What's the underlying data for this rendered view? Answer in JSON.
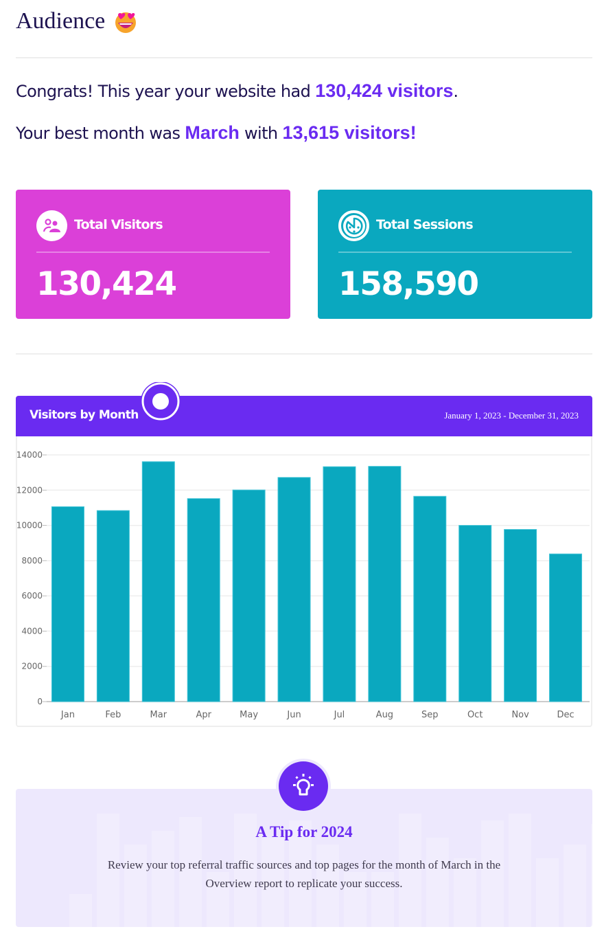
{
  "header": {
    "title": "Audience",
    "emoji_icon": "heart-eyes-emoji"
  },
  "summary": {
    "line1_prefix": "Congrats! This year your website had ",
    "line1_highlight": "130,424 visitors",
    "line1_suffix": ".",
    "line2_prefix": "Your best month was ",
    "line2_month": "March",
    "line2_middle": " with ",
    "line2_highlight": "13,615 visitors!"
  },
  "stats": [
    {
      "label": "Total Visitors",
      "value": "130,424",
      "icon": "users-icon",
      "color": "#db40d8"
    },
    {
      "label": "Total Sessions",
      "value": "158,590",
      "icon": "sessions-clock-icon",
      "color": "#0aa8bf"
    }
  ],
  "chart_section": {
    "title": "Visitors by Month",
    "date_range": "January 1, 2023 - December 31, 2023",
    "header_color": "#6a2bf1",
    "bar_color": "#0aa8bf"
  },
  "chart_data": {
    "type": "bar",
    "title": "Visitors by Month",
    "xlabel": "",
    "ylabel": "",
    "categories": [
      "Jan",
      "Feb",
      "Mar",
      "Apr",
      "May",
      "Jun",
      "Jul",
      "Aug",
      "Sep",
      "Oct",
      "Nov",
      "Dec"
    ],
    "values": [
      11060,
      10840,
      13615,
      11520,
      12010,
      12720,
      13330,
      13350,
      11650,
      10000,
      9770,
      8380
    ],
    "ylim": [
      0,
      14000
    ],
    "yticks": [
      0,
      2000,
      4000,
      6000,
      8000,
      10000,
      12000,
      14000
    ],
    "grid": true,
    "legend": "none"
  },
  "tip": {
    "title": "A Tip for 2024",
    "text": "Review your top referral traffic sources and top pages for the month of March in the Overview report to replicate your success.",
    "icon": "lightbulb-icon"
  }
}
